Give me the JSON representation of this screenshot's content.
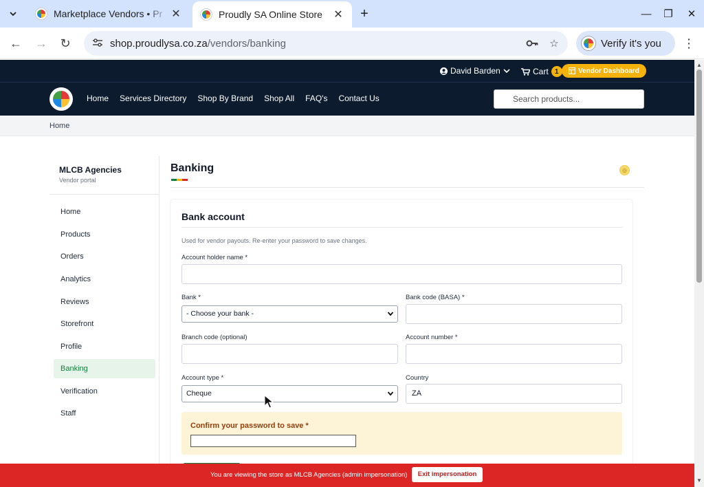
{
  "browser": {
    "tabs": [
      {
        "title": "Marketplace Vendors • Pr",
        "active": false
      },
      {
        "title": "Proudly SA Online Store",
        "active": true
      }
    ],
    "url_host": "shop.proudlysa.co.za",
    "url_path": "/vendors/banking",
    "verify_label": "Verify it's you"
  },
  "topbar": {
    "user_name": "David Barden",
    "cart_label": "Cart",
    "cart_count": "1",
    "vendor_dashboard_label": "Vendor Dashboard"
  },
  "nav": {
    "links": [
      "Home",
      "Services Directory",
      "Shop By Brand",
      "Shop All",
      "FAQ's",
      "Contact Us"
    ],
    "search_placeholder": "Search products..."
  },
  "breadcrumb": "Home",
  "sidebar": {
    "vendor_name": "MLCB Agencies",
    "vendor_sub": "Vendor portal",
    "items": [
      "Home",
      "Products",
      "Orders",
      "Analytics",
      "Reviews",
      "Storefront",
      "Profile",
      "Banking",
      "Verification",
      "Staff"
    ],
    "active": "Banking"
  },
  "page": {
    "title": "Banking",
    "flag_colors": [
      "#15803d",
      "#f5b20a",
      "#dc2626"
    ]
  },
  "form": {
    "card_title": "Bank account",
    "hint": "Used for vendor payouts. Re-enter your password to save changes.",
    "account_holder_label": "Account holder name *",
    "bank_label": "Bank *",
    "bank_value": "- Choose your bank -",
    "bank_code_label": "Bank code (BASA) *",
    "branch_code_label": "Branch code (optional)",
    "account_number_label": "Account number *",
    "account_type_label": "Account type *",
    "account_type_value": "Cheque",
    "country_label": "Country",
    "country_value": "ZA",
    "password_label": "Confirm your password to save *"
  },
  "impersonation": {
    "text": "You are viewing the store as MLCB Agencies (admin impersonation)",
    "button": "Exit impersonation"
  }
}
